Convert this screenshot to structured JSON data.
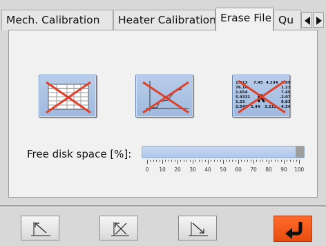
{
  "tabs": [
    {
      "label": "Mech. Calibration",
      "active": false
    },
    {
      "label": "Heater Calibration",
      "active": false
    },
    {
      "label": "Erase File",
      "active": true
    },
    {
      "label": "Qu",
      "active": false
    }
  ],
  "tab_scroll": {
    "left_icon": "arrow-left-icon",
    "right_icon": "arrow-right-icon"
  },
  "erase_buttons": [
    {
      "name": "erase-table-file",
      "icon": "table-crossed-icon"
    },
    {
      "name": "erase-graph-file",
      "icon": "graph-crossed-icon"
    },
    {
      "name": "erase-results-file",
      "icon": "results-crossed-icon",
      "text": {
        "r1": "1.213",
        "r1b": "7.45",
        "r1c": "4.234",
        "r1d": "1.99",
        "r2": "76.14",
        "r2d": "1.23",
        "r3": "1.654",
        "r3d": "7.45",
        "r4": "5.4331",
        "r4d": ".2.07",
        "r5": "1.23",
        "r5d": "9.83",
        "r6": "2.543",
        "r6b": "1.44",
        "r6c": "3.212",
        "r6d": "4.34",
        "big": "R"
      }
    }
  ],
  "disk": {
    "label": "Free disk space [%]:",
    "value_percent": 95,
    "scale_labels": [
      "0",
      "10",
      "20",
      "30",
      "40",
      "50",
      "60",
      "70",
      "80",
      "90",
      "100"
    ]
  },
  "toolbar": {
    "buttons": [
      "arrow-up-left-icon",
      "arrow-cross-icon",
      "arrow-down-right-icon"
    ],
    "back_icon": "return-arrow-icon"
  },
  "colors": {
    "accent_button": "#e84d10",
    "progress": "#aec6ea",
    "cross": "#e0402a"
  }
}
